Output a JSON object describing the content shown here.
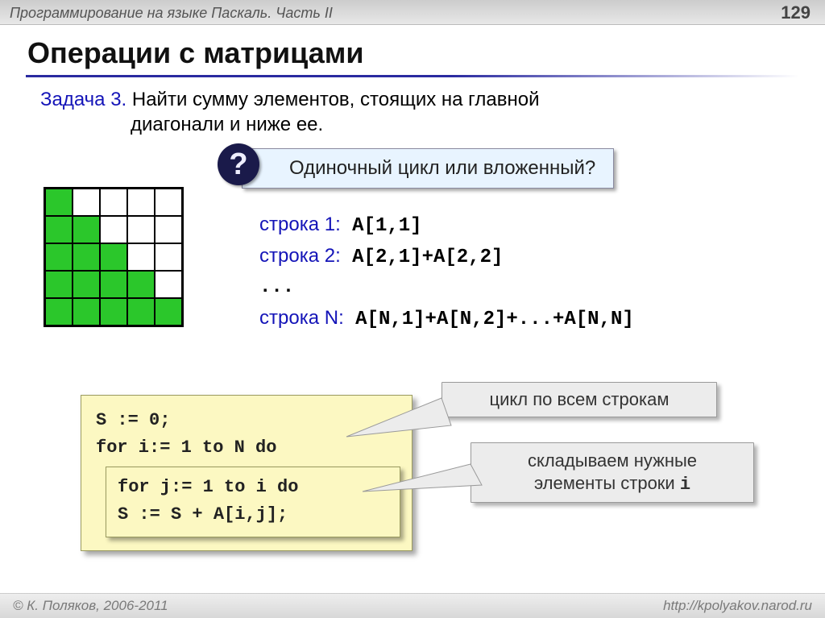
{
  "header": {
    "title": "Программирование на языке Паскаль. Часть II",
    "page": "129"
  },
  "slide_title": "Операции с матрицами",
  "task": {
    "label": "Задача 3.",
    "text_a": " Найти сумму элементов, стоящих  на главной",
    "text_b": "диагонали и ниже ее."
  },
  "question": "Одиночный цикл или вложенный?",
  "lines": {
    "r1_lbl": "строка 1:",
    "r1_code": " A[1,1]",
    "r2_lbl": "строка 2:",
    "r2_code": " A[2,1]+A[2,2]",
    "dots": "...",
    "rN_lbl": "строка N:",
    "rN_code": " A[N,1]+A[N,2]+...+A[N,N]"
  },
  "code": {
    "l1": "S := 0;",
    "l2": "for i:= 1 to N do",
    "l3": "for j:= 1 to i do",
    "l4": "  S := S + A[i,j];"
  },
  "notes": {
    "n1": "цикл по всем строкам",
    "n2a": "складываем нужные",
    "n2b": "элементы строки ",
    "n2c": "i"
  },
  "footer": {
    "left": "© К. Поляков, 2006-2011",
    "right": "http://kpolyakov.narod.ru"
  }
}
